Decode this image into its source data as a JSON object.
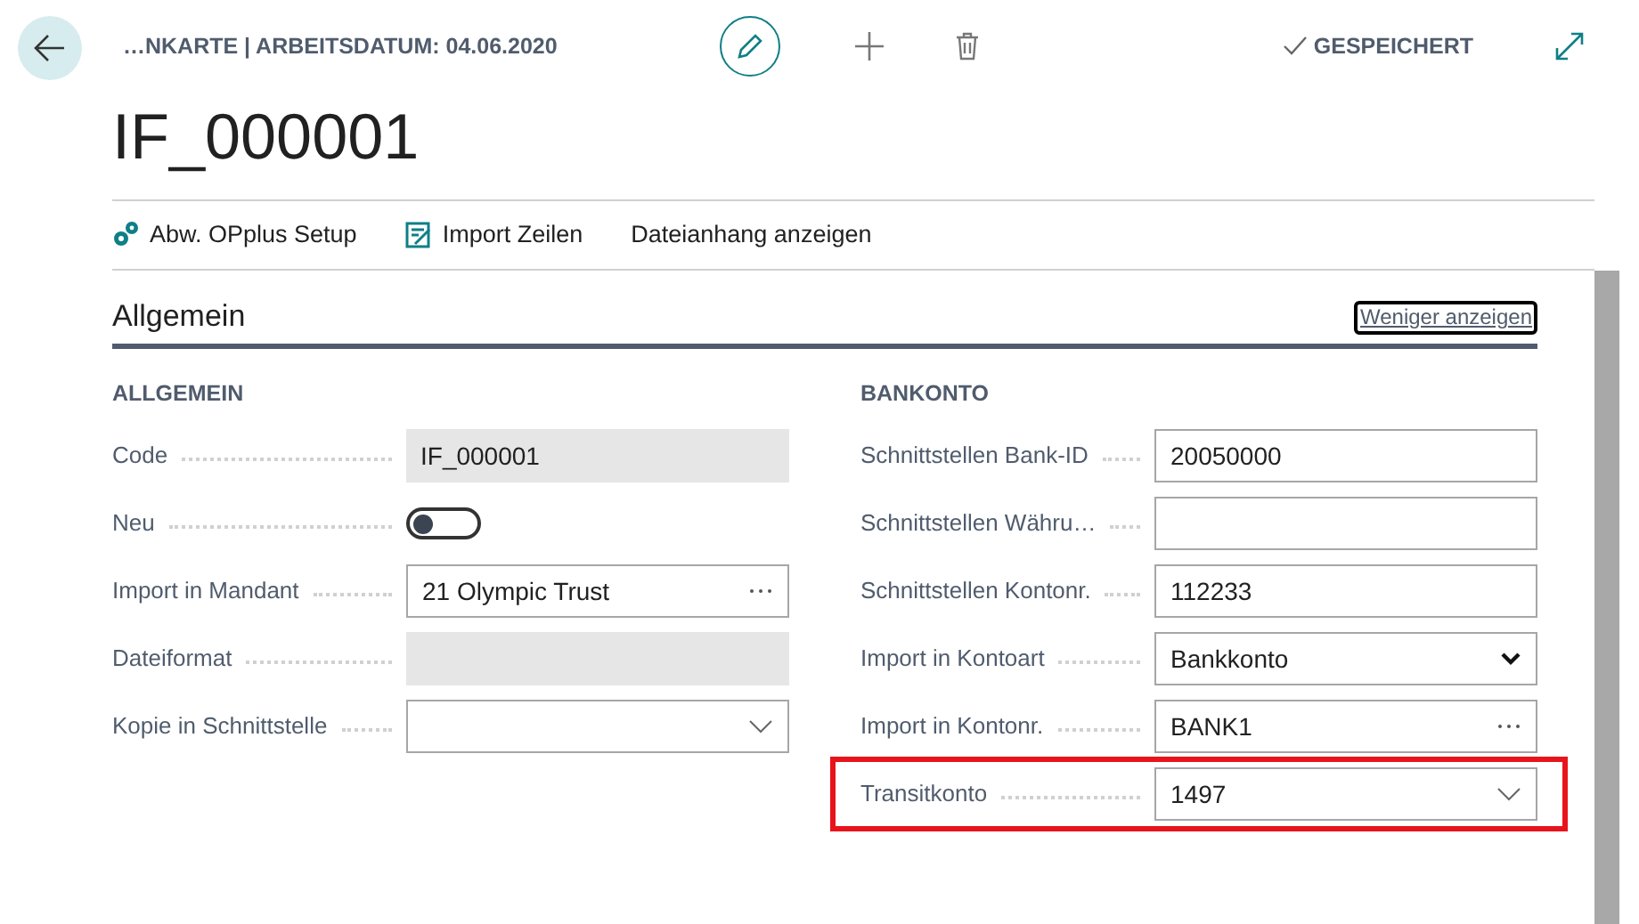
{
  "header": {
    "breadcrumb": "…NKARTE | ARBEITSDATUM: 04.06.2020",
    "status": "GESPEICHERT"
  },
  "title": "IF_000001",
  "actions": [
    {
      "label": "Abw. OPplus Setup",
      "kind": "setup"
    },
    {
      "label": "Import Zeilen",
      "kind": "import"
    },
    {
      "label": "Dateianhang anzeigen",
      "kind": "plain"
    }
  ],
  "section": {
    "title": "Allgemein",
    "toggle_label": "Weniger anzeigen"
  },
  "groups": [
    {
      "title": "ALLGEMEIN",
      "fields": [
        {
          "label": "Code",
          "kind": "readonly",
          "value": "IF_000001",
          "highlighted": false
        },
        {
          "label": "Neu",
          "kind": "toggle",
          "on": false,
          "highlighted": false
        },
        {
          "label": "Import in Mandant",
          "kind": "lookup",
          "value": "21 Olympic Trust",
          "highlighted": false
        },
        {
          "label": "Dateiformat",
          "kind": "readonly",
          "highlighted": false
        },
        {
          "label": "Kopie in Schnittstelle",
          "kind": "dropdown",
          "highlighted": false
        }
      ]
    },
    {
      "title": "BANKONTO",
      "fields": [
        {
          "label": "Schnittstellen Bank-ID",
          "kind": "text",
          "value": "20050000",
          "highlighted": false
        },
        {
          "label": "Schnittstellen Währu…",
          "kind": "text",
          "highlighted": false
        },
        {
          "label": "Schnittstellen Kontonr.",
          "kind": "text",
          "value": "112233",
          "highlighted": false
        },
        {
          "label": "Import in Kontoart",
          "kind": "select",
          "value": "Bankkonto",
          "highlighted": false
        },
        {
          "label": "Import in Kontonr.",
          "kind": "lookup",
          "value": "BANK1",
          "highlighted": false
        },
        {
          "label": "Transitkonto",
          "kind": "dropdown",
          "value": "1497",
          "highlighted": true
        }
      ]
    }
  ]
}
